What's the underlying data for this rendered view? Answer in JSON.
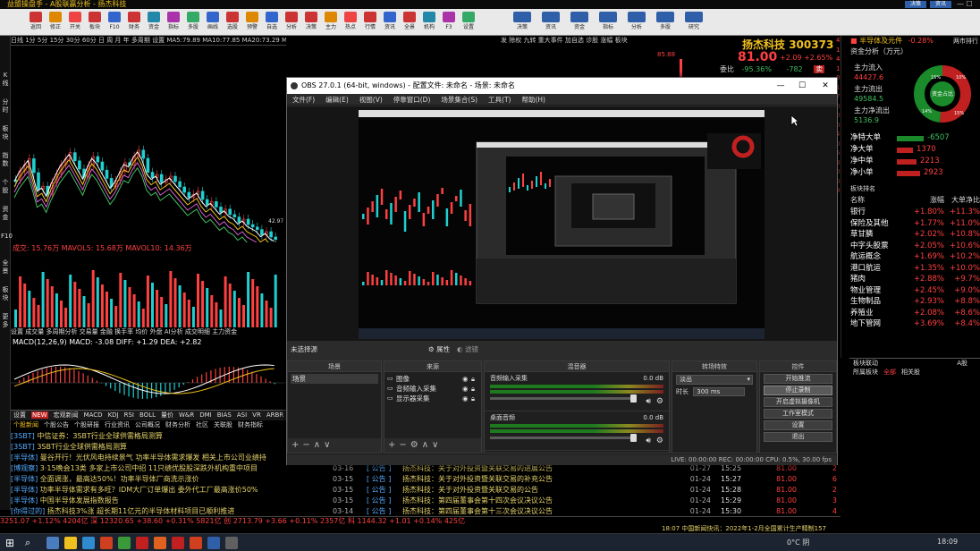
{
  "titlebar": {
    "text": "益盟操盘手 - A股联赢分析 - 扬杰科技"
  },
  "toolbar": {
    "items": [
      "返回",
      "修正",
      "开关",
      "板块",
      "F10",
      "财务",
      "资金",
      "指标",
      "多股",
      "画线",
      "选股",
      "预警",
      "自选",
      "分析",
      "决策",
      "主力",
      "热点",
      "行情",
      "资讯",
      "全景",
      "机构",
      "F3",
      "设置"
    ],
    "right_labels": [
      "决策",
      "资讯",
      "资金",
      "指标",
      "分析",
      "多股",
      "研究"
    ]
  },
  "left_strip": [
    "K线",
    "分时",
    "板块",
    "指数",
    "个股",
    "资金",
    "F10",
    "全景",
    "板块",
    "更多"
  ],
  "chart_tabs": "日线  1分  5分  15分  30分  60分  日  周  月  年  多周期  设置  MA5:79.89  MA10:77.85  MA20:73.29  MA30:69.90",
  "chart_top_right": "发  除权  九转  重大事件  加自选  诊股  涨幅  板块",
  "chart_data": {
    "type": "line",
    "price_high_label": "85.88",
    "price_low_label": "42.97"
  },
  "vol_label": "成交: 15.76万  MAVOL5: 15.68万  MAVOL10: 14.36万",
  "sub_tabs": "设置  成交量  多周期分析  交易量  金融  换手率  均价  外盘  AI分析  成交明细  主力资金",
  "macd_label": "MACD(12,26,9)  MACD: -3.08  DIFF: +1.29  DEA: +2.82",
  "bottom_tabs": [
    "设置",
    "NEW",
    "宏观新闻",
    "MACD",
    "KDJ",
    "RSI",
    "BOLL",
    "量价",
    "W&R",
    "DMI",
    "BIAS",
    "ASI",
    "VR",
    "ARBR"
  ],
  "bottom_tabs2": [
    "个股新闻",
    "个股公告",
    "个股研报",
    "行业资讯",
    "公司概况",
    "财务分析",
    "社区",
    "关联股",
    "财务指标"
  ],
  "news": [
    {
      "tag": "[3SBT]",
      "text": "中信证券：3SBT行业全球供需格局测算"
    },
    {
      "tag": "[3SBT]",
      "text": "3SBT行业全球供需格局测算"
    },
    {
      "tag": "[半导体]",
      "text": "曼谷开行！光伏风电持续景气 功率半导体需求爆发 相关上市公司业绩持"
    },
    {
      "tag": "[博观察]",
      "text": "3·15晚会13类 多家上市公司中招 11只绩优股股深跌外机构重中项目"
    },
    {
      "tag": "[半导体]",
      "text": "全面调涨，最高达50%！功率半导体厂商洗示涨价"
    },
    {
      "tag": "[半导体]",
      "text": "功率半导体需求有多旺？IDM大厂订单爆出 委外代工厂最高涨价50%"
    },
    {
      "tag": "[半导体]",
      "text": "中国半导体发展指数报告"
    },
    {
      "tag": "[你得过的]",
      "text": "扬杰科技3%涨  超长期11亿元的半导体材料项目已顺利推进"
    }
  ],
  "announcements": [
    {
      "t1": "[ 公告 ]",
      "t2": "扬杰科技：关于对外投资暨关联交易的进展公告",
      "t3": "03-16"
    },
    {
      "t1": "[ 公告 ]",
      "t2": "扬杰科技：关于对外投资暨关联交易的补充公告",
      "t3": "03-15"
    },
    {
      "t1": "[ 公告 ]",
      "t2": "扬杰科技：关于对外投资暨关联交易的公告",
      "t3": "03-15"
    },
    {
      "t1": "[ 公告 ]",
      "t2": "扬杰科技：第四届董事会第十四次会议决议公告",
      "t3": "03-15"
    },
    {
      "t1": "[ 公告 ]",
      "t2": "扬杰科技：第四届董事会第十三次会议决议公告",
      "t3": "03-15"
    }
  ],
  "news_dates": [
    "03-16",
    "03-15",
    "03-15",
    "03-15",
    "03-14"
  ],
  "ann_dates": [
    "01-27",
    "01-24",
    "01-24",
    "01-24",
    "01-24"
  ],
  "ticks": [
    {
      "tm": "15:25",
      "pr": "81.00",
      "q": "2"
    },
    {
      "tm": "15:27",
      "pr": "81.00",
      "q": "6"
    },
    {
      "tm": "15:28",
      "pr": "81.00",
      "q": "2"
    },
    {
      "tm": "15:29",
      "pr": "81.00",
      "q": "3"
    },
    {
      "tm": "15:30",
      "pr": "81.00",
      "q": "4"
    }
  ],
  "index_bar": "3251.07  +1.12%  4204亿  深  12320.65  +38.60  +0.31%  5821亿  创  2713.79  +3.66  +0.11%  2357亿  科  1144.32  +1.01  +0.14%  425亿",
  "stock": {
    "name": "扬杰科技",
    "code": "300373",
    "price": "81.00",
    "change": "+2.09",
    "pct": "+2.65%",
    "weibi_label": "委比",
    "weibi": "-95.36%",
    "weicha": "-782",
    "sell": "卖"
  },
  "order_book_top": "85.88",
  "cap_panel": {
    "title": "半导体及元件",
    "title_pct": "-0.28%",
    "right_label": "两市排行",
    "sub": "资金分析（万元）",
    "main_in_label": "主力流入",
    "main_in": "44427.6",
    "main_out_label": "主力流出",
    "main_out": "49584.5",
    "main_net_label": "主力净流出",
    "main_net": "5136.9",
    "donut_center": "资金占比",
    "donut_labels": [
      "15%",
      "10%",
      "14%",
      "15%"
    ],
    "flows": [
      {
        "label": "净特大单",
        "val": "-6507"
      },
      {
        "label": "净大单",
        "val": "1370"
      },
      {
        "label": "净中单",
        "val": "2213"
      },
      {
        "label": "净小单",
        "val": "2923"
      }
    ],
    "list_header": [
      "名称",
      "涨幅",
      "大单净比"
    ],
    "list_title": "板块排名",
    "sectors": [
      {
        "n": "银行",
        "p": "+1.80%",
        "f": "+11.3%"
      },
      {
        "n": "保险及其他",
        "p": "+1.77%",
        "f": "+11.0%"
      },
      {
        "n": "草甘膦",
        "p": "+2.02%",
        "f": "+10.8%"
      },
      {
        "n": "中字头股票",
        "p": "+2.05%",
        "f": "+10.6%"
      },
      {
        "n": "航运概念",
        "p": "+1.69%",
        "f": "+10.2%"
      },
      {
        "n": "港口航运",
        "p": "+1.35%",
        "f": "+10.0%"
      },
      {
        "n": "猪肉",
        "p": "+2.88%",
        "f": "+9.7%"
      },
      {
        "n": "物业管理",
        "p": "+2.45%",
        "f": "+9.0%"
      },
      {
        "n": "生物制品",
        "p": "+2.93%",
        "f": "+8.8%"
      },
      {
        "n": "养殖业",
        "p": "+2.08%",
        "f": "+8.6%"
      },
      {
        "n": "地下管网",
        "p": "+3.69%",
        "f": "+8.4%"
      }
    ],
    "far_strip": [
      "463",
      "12",
      "43",
      "1",
      "0",
      "1",
      "7",
      "0",
      "0",
      "08",
      "45",
      "0",
      "562",
      "81",
      "0",
      "0",
      "91"
    ],
    "bottom_title": "板块联动",
    "bottom_right": "A股",
    "bottom_tabs": [
      "所属板块",
      "全部",
      "相关股"
    ]
  },
  "status_line": "18:07  中国新闻快讯：2022年1-2月全国累计生产精制157",
  "obs": {
    "title": "OBS 27.0.1 (64-bit, windows) - 配置文件: 未命名 - 场景: 未命名",
    "menu": [
      "文件(F)",
      "编辑(E)",
      "视图(V)",
      "停靠窗口(D)",
      "场景集合(S)",
      "工具(T)",
      "帮助(H)"
    ],
    "scene_label": "未选择源",
    "prop_btn": "属性",
    "filter_btn": "滤镜",
    "docks": {
      "scenes_title": "场景",
      "scenes": [
        "场景"
      ],
      "sources_title": "来源",
      "sources": [
        "图像",
        "音频输入采集",
        "显示器采集"
      ],
      "mixer_title": "混音器",
      "mixer": [
        {
          "name": "音频输入采集",
          "db": "0.0 dB"
        },
        {
          "name": "桌面音频",
          "db": "0.0 dB"
        }
      ],
      "trans_title": "转场特效",
      "trans_value": "淡出",
      "trans_dur_label": "时长",
      "trans_dur": "300 ms",
      "ctrl_title": "控件",
      "controls": [
        "开始推流",
        "停止录制",
        "开启虚拟摄像机",
        "工作室模式",
        "设置",
        "退出"
      ]
    },
    "status": "LIVE: 00:00:00   REC: 00:00:00   CPU: 0.5%, 30.00 fps"
  },
  "taskbar": {
    "time": "18:09",
    "weather": "0°C 阴",
    "cursor": "X"
  }
}
